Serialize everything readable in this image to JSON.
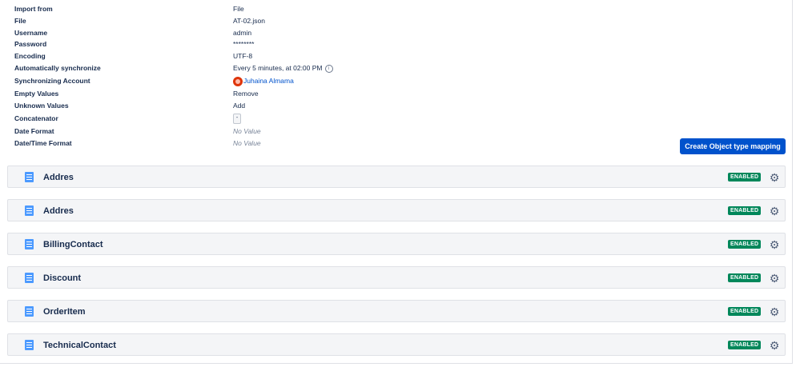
{
  "properties": [
    {
      "label": "Import from",
      "value": "File"
    },
    {
      "label": "File",
      "value": "AT-02.json"
    },
    {
      "label": "Username",
      "value": "admin"
    },
    {
      "label": "Password",
      "value": "********"
    },
    {
      "label": "Encoding",
      "value": "UTF-8"
    },
    {
      "label": "Automatically synchronize",
      "value": "Every 5 minutes, at 02:00 PM"
    },
    {
      "label": "Synchronizing Account",
      "value": "Juhaina Almama"
    },
    {
      "label": "Empty Values",
      "value": "Remove"
    },
    {
      "label": "Unknown Values",
      "value": "Add"
    },
    {
      "label": "Concatenator",
      "value": "-"
    },
    {
      "label": "Date Format",
      "value": "No Value"
    },
    {
      "label": "Date/Time Format",
      "value": "No Value"
    }
  ],
  "info_glyph": "i",
  "create_button": "Create Object type mapping",
  "object_types": [
    {
      "name": "Addres",
      "status": "ENABLED"
    },
    {
      "name": "Addres",
      "status": "ENABLED"
    },
    {
      "name": "BillingContact",
      "status": "ENABLED"
    },
    {
      "name": "Discount",
      "status": "ENABLED"
    },
    {
      "name": "OrderItem",
      "status": "ENABLED"
    },
    {
      "name": "TechnicalContact",
      "status": "ENABLED"
    }
  ],
  "colors": {
    "primary": "#0052cc",
    "enabled": "#00875a",
    "avatar": "#de350b"
  }
}
